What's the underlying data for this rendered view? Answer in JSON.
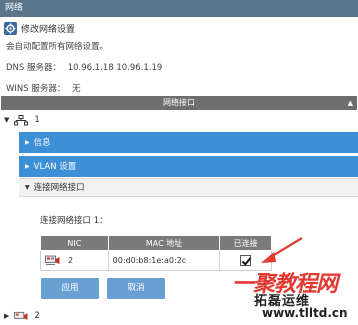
{
  "window": {
    "title": "网络"
  },
  "modify": {
    "title": "修改网络设置",
    "desc": "会自动配置所有网络设置。"
  },
  "dns": {
    "label": "DNS 服务器：",
    "value": "10.96.1.18  10.96.1.19"
  },
  "wins": {
    "label": "WINS 服务器：",
    "value": "无"
  },
  "interfaces": {
    "header": "网络接口",
    "node1_label": "1",
    "node2_label": "2"
  },
  "panels": {
    "info": "信息",
    "vlan": "VLAN 设置",
    "connect": "连接网络接口"
  },
  "connect_section": {
    "label": "连接网络接口 1：",
    "columns": [
      "NIC",
      "MAC 地址",
      "已连接"
    ],
    "row": {
      "nic": "2",
      "mac": "00:d0:b8:1e:a0:2c",
      "connected": true
    }
  },
  "buttons": {
    "apply": "应用",
    "cancel": "取消"
  },
  "watermark": {
    "line1": "一聚教程网",
    "line2": "拓磊运维",
    "line3": "www.tlltd.cn"
  },
  "colors": {
    "titlebar": "#5a7489",
    "panel_blue": "#3d8fd6",
    "button_blue": "#6a9fd4",
    "table_header": "#7a7a7a",
    "arrow": "#e23a33"
  }
}
